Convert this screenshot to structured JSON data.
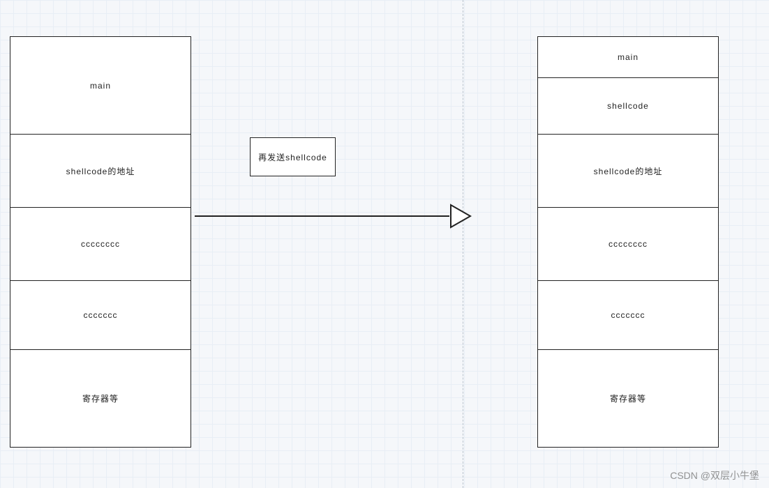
{
  "left_stack": {
    "cells": [
      {
        "label": "main"
      },
      {
        "label": "shellcode的地址"
      },
      {
        "label": "cccccccc"
      },
      {
        "label": "ccccccc"
      },
      {
        "label": "寄存器等"
      }
    ]
  },
  "right_stack": {
    "cells": [
      {
        "label": "main"
      },
      {
        "label": "shellcode"
      },
      {
        "label": "shellcode的地址"
      },
      {
        "label": "cccccccc"
      },
      {
        "label": "ccccccc"
      },
      {
        "label": "寄存器等"
      }
    ]
  },
  "center_box": {
    "label": "再发送shellcode"
  },
  "watermark": "CSDN @双层小牛堡"
}
